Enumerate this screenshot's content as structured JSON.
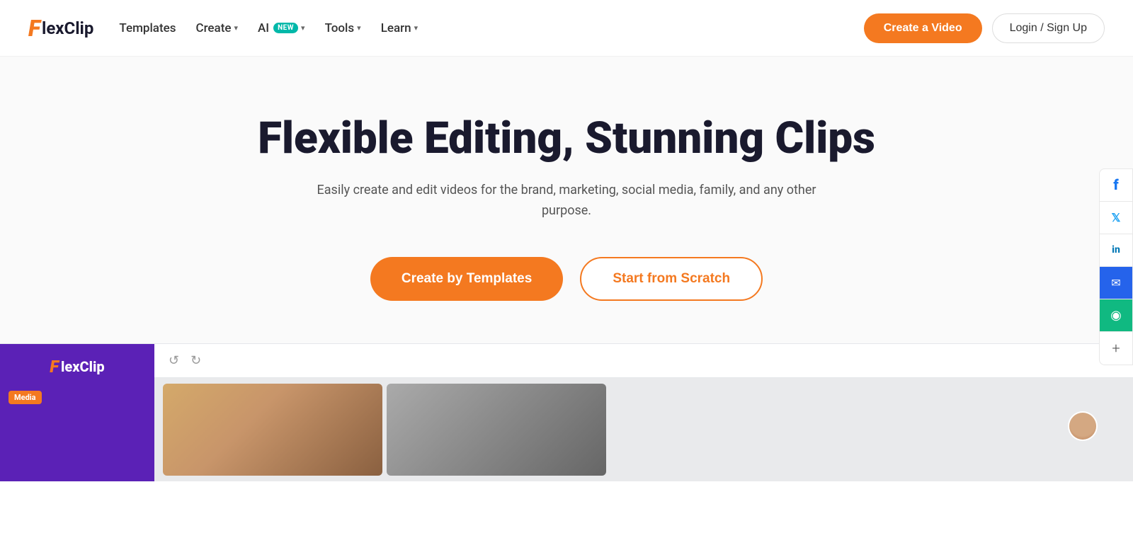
{
  "logo": {
    "f": "F",
    "rest": "lexClip"
  },
  "nav": {
    "links": [
      {
        "id": "templates",
        "label": "Templates",
        "hasChevron": false
      },
      {
        "id": "create",
        "label": "Create",
        "hasChevron": true
      },
      {
        "id": "ai",
        "label": "AI",
        "hasChevron": true,
        "badge": "NEW"
      },
      {
        "id": "tools",
        "label": "Tools",
        "hasChevron": true
      },
      {
        "id": "learn",
        "label": "Learn",
        "hasChevron": true
      }
    ],
    "cta_label": "Create a Video",
    "login_label": "Login / Sign Up"
  },
  "hero": {
    "title": "Flexible Editing, Stunning Clips",
    "subtitle": "Easily create and edit videos for the brand, marketing, social media, family, and any other purpose.",
    "btn_templates": "Create by Templates",
    "btn_scratch": "Start from Scratch"
  },
  "social": {
    "items": [
      {
        "id": "facebook",
        "symbol": "f",
        "class": "fb"
      },
      {
        "id": "twitter",
        "symbol": "𝕏",
        "class": "tw"
      },
      {
        "id": "linkedin",
        "symbol": "in",
        "class": "li"
      },
      {
        "id": "email",
        "symbol": "✉",
        "class": "email"
      },
      {
        "id": "chat",
        "symbol": "◎",
        "class": "chat"
      },
      {
        "id": "plus",
        "symbol": "+",
        "class": "plus"
      }
    ]
  },
  "preview": {
    "logo_f": "F",
    "logo_rest": "lexClip",
    "media_label": "Media",
    "toolbar": {
      "undo": "↺",
      "redo": "↻"
    }
  }
}
